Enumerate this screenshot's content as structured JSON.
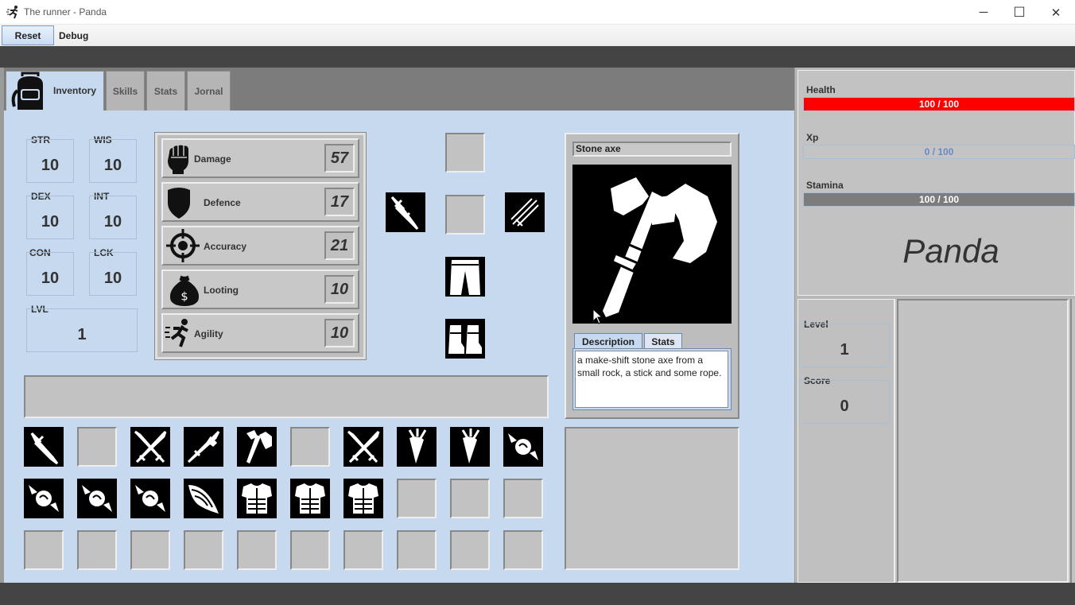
{
  "window": {
    "title": "The runner - Panda",
    "minimize": "─",
    "maximize": "☐",
    "close": "✕"
  },
  "menu": {
    "reset": "Reset",
    "debug": "Debug"
  },
  "tabs": {
    "inventory": "Inventory",
    "skills": "Skills",
    "stats": "Stats",
    "journal": "Jornal"
  },
  "stats": {
    "str": {
      "label": "STR",
      "value": "10"
    },
    "wis": {
      "label": "WIS",
      "value": "10"
    },
    "dex": {
      "label": "DEX",
      "value": "10"
    },
    "int": {
      "label": "INT",
      "value": "10"
    },
    "con": {
      "label": "CON",
      "value": "10"
    },
    "lck": {
      "label": "LCK",
      "value": "10"
    },
    "lvl": {
      "label": "LVL",
      "value": "1"
    }
  },
  "attributes": {
    "damage": {
      "label": "Damage",
      "value": "57",
      "icon": "fist-icon"
    },
    "defence": {
      "label": "Defence",
      "value": "17",
      "icon": "shield-icon"
    },
    "accuracy": {
      "label": "Accuracy",
      "value": "21",
      "icon": "crosshair-icon"
    },
    "looting": {
      "label": "Looting",
      "value": "10",
      "icon": "money-bag-icon"
    },
    "agility": {
      "label": "Agility",
      "value": "10",
      "icon": "running-man-icon"
    }
  },
  "equipment": {
    "weapon_left": "dagger-icon",
    "weapon_right": "claws-icon",
    "legs": "pants-icon",
    "feet": "boots-icon"
  },
  "item_detail": {
    "name": "Stone axe",
    "image": "stone-axe-icon",
    "tab_description": "Description",
    "tab_stats": "Stats",
    "description": "a make-shift stone axe from a small rock, a stick and some rope."
  },
  "inventory": [
    "dagger-icon",
    "",
    "crossed-swords-icon",
    "sword-pair-icon",
    "stone-axe-icon",
    "",
    "crossed-swords-icon",
    "carrot-icon",
    "carrot-icon",
    "candy-icon",
    "candy-icon",
    "candy-icon",
    "candy-icon",
    "wing-icon",
    "chest-armor-icon",
    "chest-armor-icon",
    "chest-armor-icon",
    "",
    "",
    "",
    "",
    "",
    "",
    "",
    "",
    "",
    "",
    "",
    "",
    ""
  ],
  "player": {
    "health_label": "Health",
    "health_text": "100 / 100",
    "health_fraction": 1.0,
    "xp_label": "Xp",
    "xp_text": "0 / 100",
    "xp_fraction": 0.0,
    "stamina_label": "Stamina",
    "stamina_text": "100 / 100",
    "stamina_fraction": 1.0,
    "name": "Panda",
    "level_label": "Level",
    "level": "1",
    "score_label": "Score",
    "score": "0"
  },
  "colors": {
    "health": "#ff0000",
    "stamina": "#7c7c7c",
    "xp_text": "#6a88c8",
    "panel": "#c6d9ee"
  }
}
